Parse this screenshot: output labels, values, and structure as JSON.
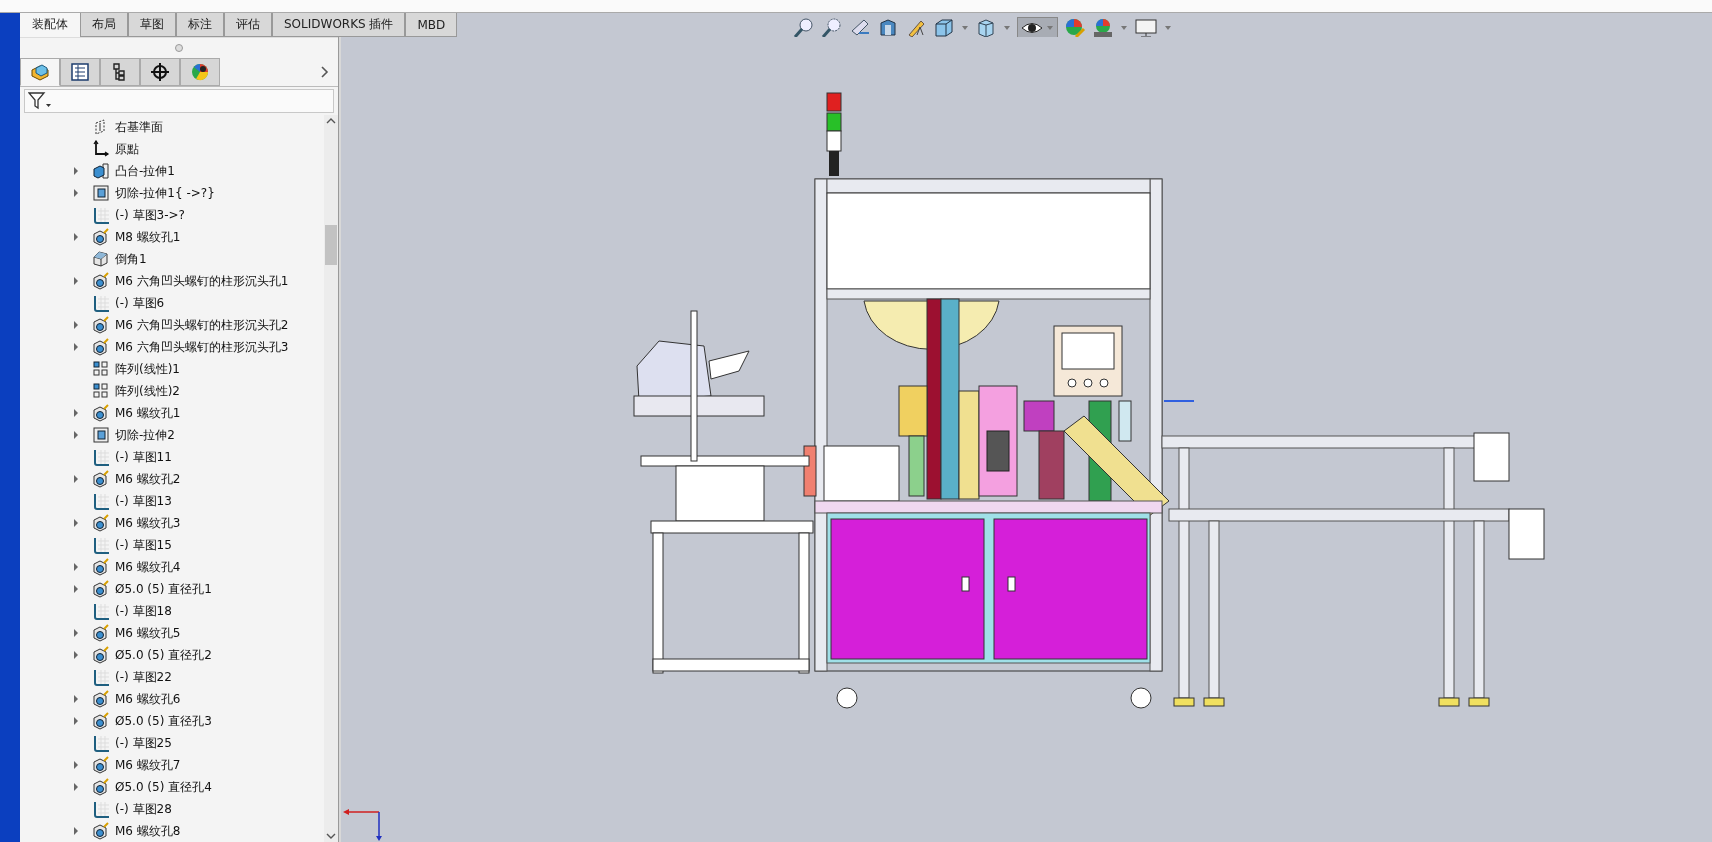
{
  "tabs": [
    {
      "label": "装配体",
      "selected": true
    },
    {
      "label": "布局",
      "selected": false
    },
    {
      "label": "草图",
      "selected": false
    },
    {
      "label": "标注",
      "selected": false
    },
    {
      "label": "评估",
      "selected": false
    },
    {
      "label": "SOLIDWORKS 插件",
      "selected": false
    },
    {
      "label": "MBD",
      "selected": false
    }
  ],
  "panel_tabs": [
    {
      "kind": "feature",
      "selected": true
    },
    {
      "kind": "property",
      "selected": false
    },
    {
      "kind": "config",
      "selected": false
    },
    {
      "kind": "dimxpert",
      "selected": false
    },
    {
      "kind": "display",
      "selected": false
    }
  ],
  "tree": {
    "items": [
      {
        "label": "右基準面",
        "kind": "plane",
        "expandable": false
      },
      {
        "label": "原點",
        "kind": "origin",
        "expandable": false
      },
      {
        "label": "凸台-拉伸1",
        "kind": "boss",
        "expandable": true
      },
      {
        "label": "切除-拉伸1{ ->?}",
        "kind": "cut",
        "expandable": true
      },
      {
        "label": "(-) 草图3->?",
        "kind": "sketch",
        "expandable": false
      },
      {
        "label": "M8 螺纹孔1",
        "kind": "hole",
        "expandable": true
      },
      {
        "label": "倒角1",
        "kind": "chamfer",
        "expandable": false
      },
      {
        "label": "M6 六角凹头螺钉的柱形沉头孔1",
        "kind": "hole",
        "expandable": true
      },
      {
        "label": "(-) 草图6",
        "kind": "sketch",
        "expandable": false
      },
      {
        "label": "M6 六角凹头螺钉的柱形沉头孔2",
        "kind": "hole",
        "expandable": true
      },
      {
        "label": "M6 六角凹头螺钉的柱形沉头孔3",
        "kind": "hole",
        "expandable": true
      },
      {
        "label": "阵列(线性)1",
        "kind": "pattern",
        "expandable": false
      },
      {
        "label": "阵列(线性)2",
        "kind": "pattern",
        "expandable": false
      },
      {
        "label": "M6 螺纹孔1",
        "kind": "hole",
        "expandable": true
      },
      {
        "label": "切除-拉伸2",
        "kind": "cut",
        "expandable": true
      },
      {
        "label": "(-) 草图11",
        "kind": "sketch",
        "expandable": false
      },
      {
        "label": "M6 螺纹孔2",
        "kind": "hole",
        "expandable": true
      },
      {
        "label": "(-) 草图13",
        "kind": "sketch",
        "expandable": false
      },
      {
        "label": "M6 螺纹孔3",
        "kind": "hole",
        "expandable": true
      },
      {
        "label": "(-) 草图15",
        "kind": "sketch",
        "expandable": false
      },
      {
        "label": "M6 螺纹孔4",
        "kind": "hole",
        "expandable": true
      },
      {
        "label": "Ø5.0 (5) 直径孔1",
        "kind": "hole",
        "expandable": true
      },
      {
        "label": "(-) 草图18",
        "kind": "sketch",
        "expandable": false
      },
      {
        "label": "M6 螺纹孔5",
        "kind": "hole",
        "expandable": true
      },
      {
        "label": "Ø5.0 (5) 直径孔2",
        "kind": "hole",
        "expandable": true
      },
      {
        "label": "(-) 草图22",
        "kind": "sketch",
        "expandable": false
      },
      {
        "label": "M6 螺纹孔6",
        "kind": "hole",
        "expandable": true
      },
      {
        "label": "Ø5.0 (5) 直径孔3",
        "kind": "hole",
        "expandable": true
      },
      {
        "label": "(-) 草图25",
        "kind": "sketch",
        "expandable": false
      },
      {
        "label": "M6 螺纹孔7",
        "kind": "hole",
        "expandable": true
      },
      {
        "label": "Ø5.0 (5) 直径孔4",
        "kind": "hole",
        "expandable": true
      },
      {
        "label": "(-) 草图28",
        "kind": "sketch",
        "expandable": false
      },
      {
        "label": "M6 螺纹孔8",
        "kind": "hole",
        "expandable": true
      }
    ]
  }
}
